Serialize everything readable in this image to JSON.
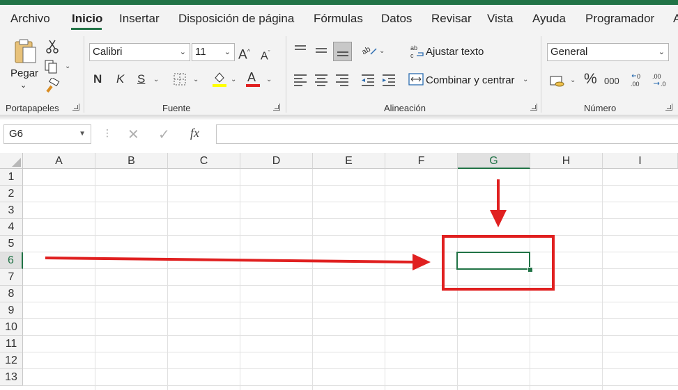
{
  "menu": {
    "tabs": [
      "Archivo",
      "Inicio",
      "Insertar",
      "Disposición de página",
      "Fórmulas",
      "Datos",
      "Revisar",
      "Vista",
      "Ayuda",
      "Programador",
      "A"
    ],
    "active_tab": "Inicio"
  },
  "clipboard": {
    "paste_label": "Pegar",
    "group_label": "Portapapeles"
  },
  "font": {
    "font_name": "Calibri",
    "font_size": "11",
    "bold": "N",
    "italic": "K",
    "underline": "S",
    "group_label": "Fuente"
  },
  "alignment": {
    "wrap_text": "Ajustar texto",
    "merge_center": "Combinar y centrar",
    "group_label": "Alineación"
  },
  "number": {
    "format": "General",
    "percent": "%",
    "thousands": "000",
    "group_label": "Número"
  },
  "formula_bar": {
    "name_box": "G6",
    "fx": "fx",
    "content": ""
  },
  "grid": {
    "columns": [
      "A",
      "B",
      "C",
      "D",
      "E",
      "F",
      "G",
      "H",
      "I"
    ],
    "rows": [
      "1",
      "2",
      "3",
      "4",
      "5",
      "6",
      "7",
      "8",
      "9",
      "10",
      "11",
      "12",
      "13"
    ],
    "selected_column": "G",
    "selected_row": "6"
  },
  "colors": {
    "accent": "#217346",
    "annotation": "#e02020"
  }
}
